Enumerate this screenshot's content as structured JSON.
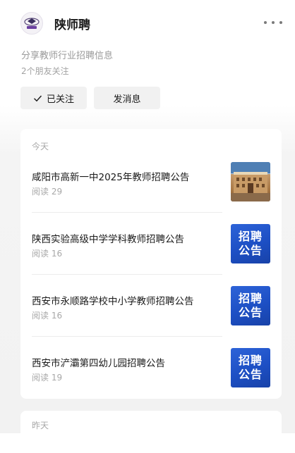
{
  "profile": {
    "name": "陕师聘",
    "description": "分享教师行业招聘信息",
    "friends_following": "2个朋友关注",
    "follow_label": "已关注",
    "message_label": "发消息",
    "more_icon": "more-dots-icon"
  },
  "sections": [
    {
      "label": "今天",
      "articles": [
        {
          "title": "咸阳市高新一中2025年教师招聘公告",
          "reads": "阅读 29",
          "thumb": "school-photo"
        },
        {
          "title": "陕西实验高级中学学科教师招聘公告",
          "reads": "阅读 16",
          "thumb_line1": "招聘",
          "thumb_line2": "公告"
        },
        {
          "title": "西安市永顺路学校中小学教师招聘公告",
          "reads": "阅读 16",
          "thumb_line1": "招聘",
          "thumb_line2": "公告"
        },
        {
          "title": "西安市浐灞第四幼儿园招聘公告",
          "reads": "阅读 19",
          "thumb_line1": "招聘",
          "thumb_line2": "公告"
        }
      ]
    },
    {
      "label": "昨天"
    }
  ],
  "colors": {
    "thumb_blue": "#2358d0",
    "muted_text": "#a8a8a8",
    "button_bg": "#f1f1f1"
  }
}
